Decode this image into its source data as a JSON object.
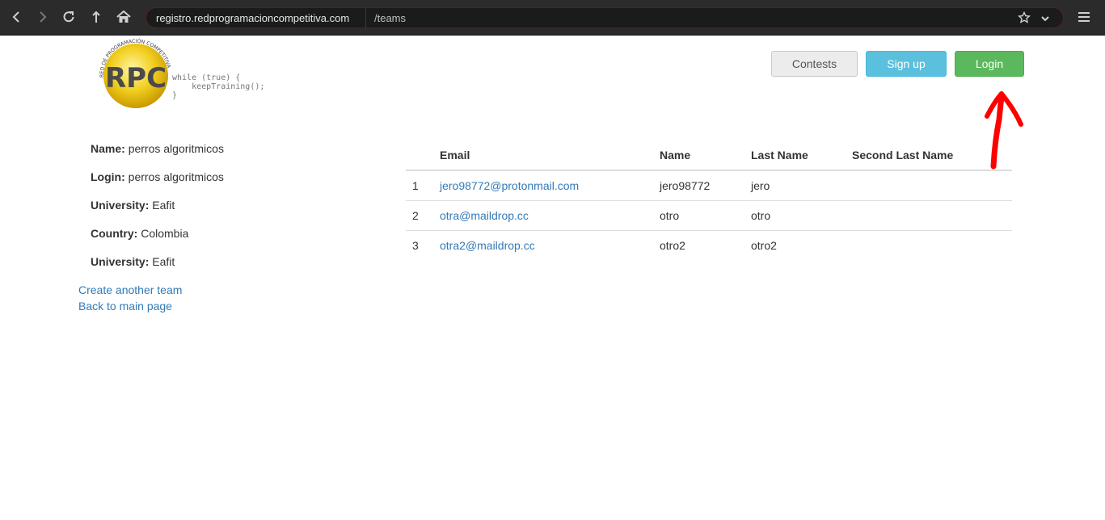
{
  "browser": {
    "url_host": "registro.redprogramacioncompetitiva.com",
    "url_path": "/teams"
  },
  "logo": {
    "letters": "RPC",
    "ring_text": "RED DE PROGRAMACIÓN COMPETITIVA",
    "code_line1": "while (true) {",
    "code_line2": "    keepTraining();",
    "code_line3": "}"
  },
  "header": {
    "contests_label": "Contests",
    "signup_label": "Sign up",
    "login_label": "Login"
  },
  "team": {
    "fields": [
      {
        "label": "Name:",
        "value": "perros algoritmicos"
      },
      {
        "label": "Login:",
        "value": "perros algoritmicos"
      },
      {
        "label": "University:",
        "value": "Eafit"
      },
      {
        "label": "Country:",
        "value": "Colombia"
      },
      {
        "label": "University:",
        "value": "Eafit"
      }
    ],
    "create_link": "Create another team",
    "back_link": "Back to main page"
  },
  "members": {
    "headers": [
      "",
      "Email",
      "Name",
      "Last Name",
      "Second Last Name"
    ],
    "rows": [
      {
        "num": "1",
        "email": "jero98772@protonmail.com",
        "name": "jero98772",
        "last_name": "jero",
        "second_last_name": ""
      },
      {
        "num": "2",
        "email": "otra@maildrop.cc",
        "name": "otro",
        "last_name": "otro",
        "second_last_name": ""
      },
      {
        "num": "3",
        "email": "otra2@maildrop.cc",
        "name": "otro2",
        "last_name": "otro2",
        "second_last_name": ""
      }
    ]
  },
  "colors": {
    "chrome_bg": "#2b2b2b",
    "link": "#337ab7",
    "signup_bg": "#5bc0de",
    "login_bg": "#5cb85c",
    "annotation_arrow": "#ff0000"
  }
}
